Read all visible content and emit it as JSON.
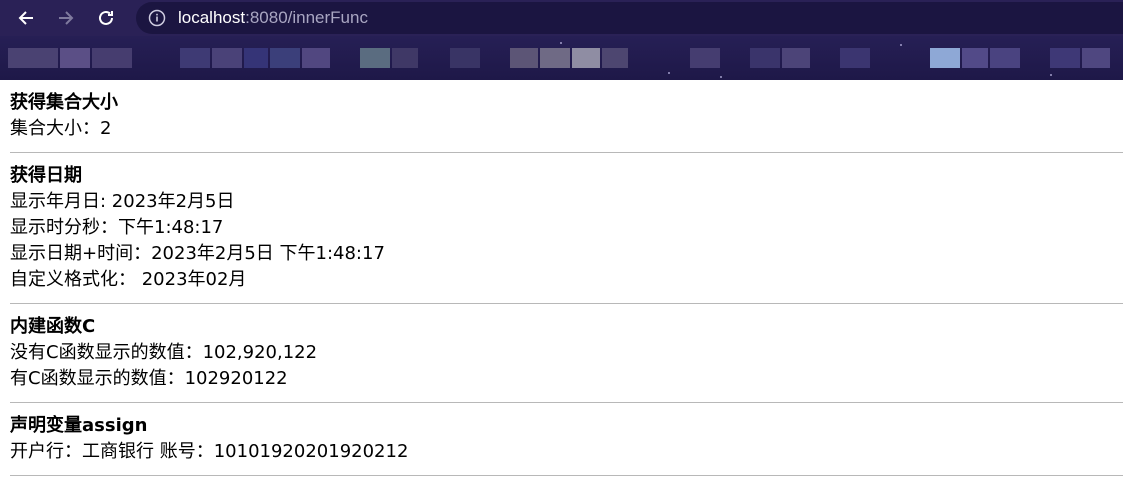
{
  "browser": {
    "url_host": "localhost",
    "url_rest": ":8080/innerFunc",
    "icons": {
      "back": "arrow-left-icon",
      "forward": "arrow-right-icon",
      "reload": "reload-icon",
      "info": "info-icon"
    },
    "colors": {
      "toolbar": "#2a2156",
      "omnibox": "#1b1541",
      "bookmarks": "#231d4c"
    }
  },
  "sections": [
    {
      "title": "获得集合大小",
      "lines": [
        "集合大小：2"
      ]
    },
    {
      "title": "获得日期",
      "lines": [
        "显示年月日: 2023年2月5日",
        "显示时分秒：下午1:48:17",
        "显示日期+时间：2023年2月5日 下午1:48:17",
        "自定义格式化： 2023年02月"
      ]
    },
    {
      "title": "内建函数C",
      "lines": [
        "没有C函数显示的数值：102,920,122",
        "有C函数显示的数值：102920122"
      ]
    },
    {
      "title": "声明变量assign",
      "lines": [
        "开户行：工商银行 账号：10101920201920212"
      ]
    }
  ]
}
